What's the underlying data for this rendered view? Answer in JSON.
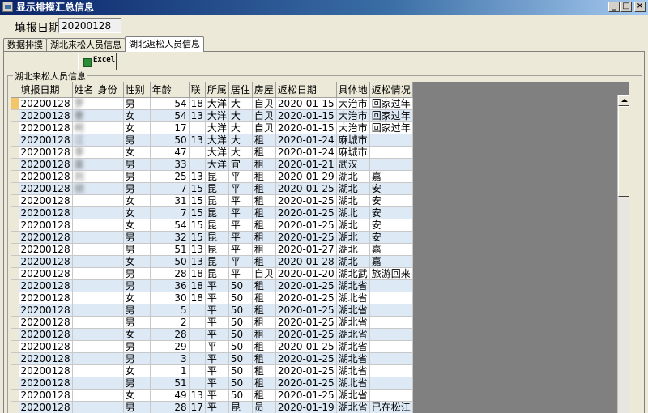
{
  "window": {
    "title": "显示排摸汇总信息",
    "buttons": {
      "minimize": "_",
      "maximize": "□",
      "close": "×"
    }
  },
  "header": {
    "label": "填报日期",
    "value": "20200128"
  },
  "tabs": [
    {
      "label": "数据排摸",
      "active": false
    },
    {
      "label": "湖北来松人员信息",
      "active": false
    },
    {
      "label": "湖北返松人员信息",
      "active": true
    }
  ],
  "toolbar": {
    "excel_label": "Excel"
  },
  "group": {
    "title": "湖北来松人员信息"
  },
  "grid": {
    "columns": [
      "填报日期",
      "姓名",
      "身份",
      "性别",
      "年龄",
      "联",
      "所属",
      "居住",
      "房屋",
      "返松日期",
      "具体地",
      "返松情况"
    ],
    "rows": [
      [
        "20200128",
        "罗",
        "",
        "男",
        "54",
        "18",
        "大洋",
        "大",
        "自贝",
        "2020-01-15",
        "大治市",
        "回家过年"
      ],
      [
        "20200128",
        "曹",
        "",
        "女",
        "54",
        "13",
        "大洋",
        "大",
        "自贝",
        "2020-01-15",
        "大治市",
        "回家过年"
      ],
      [
        "20200128",
        "柯",
        "",
        "女",
        "17",
        "",
        "大洋",
        "大",
        "自贝",
        "2020-01-15",
        "大治市",
        "回家过年"
      ],
      [
        "20200128",
        "江",
        "",
        "男",
        "50",
        "13",
        "大洋",
        "大",
        "租",
        "2020-01-24",
        "麻城市",
        ""
      ],
      [
        "20200128",
        "李",
        "",
        "女",
        "47",
        "",
        "大洋",
        "大",
        "租",
        "2020-01-24",
        "麻城市",
        ""
      ],
      [
        "20200128",
        "童",
        "",
        "男",
        "33",
        "",
        "大洋",
        "宜",
        "租",
        "2020-01-21",
        "武汉",
        ""
      ],
      [
        "20200128",
        "刘",
        "",
        "男",
        "25",
        "13",
        "昆",
        "平",
        "租",
        "2020-01-29",
        "湖北",
        "嘉"
      ],
      [
        "20200128",
        "胡",
        "",
        "男",
        "7",
        "15",
        "昆",
        "平",
        "租",
        "2020-01-25",
        "湖北",
        "安"
      ],
      [
        "20200128",
        "",
        "",
        "女",
        "31",
        "15",
        "昆",
        "平",
        "租",
        "2020-01-25",
        "湖北",
        "安"
      ],
      [
        "20200128",
        "",
        "",
        "女",
        "7",
        "15",
        "昆",
        "平",
        "租",
        "2020-01-25",
        "湖北",
        "安"
      ],
      [
        "20200128",
        "",
        "",
        "女",
        "54",
        "15",
        "昆",
        "平",
        "租",
        "2020-01-25",
        "湖北",
        "安"
      ],
      [
        "20200128",
        "",
        "",
        "男",
        "32",
        "15",
        "昆",
        "平",
        "租",
        "2020-01-25",
        "湖北",
        "安"
      ],
      [
        "20200128",
        "",
        "",
        "男",
        "51",
        "13",
        "昆",
        "平",
        "租",
        "2020-01-27",
        "湖北",
        "嘉"
      ],
      [
        "20200128",
        "",
        "",
        "女",
        "50",
        "13",
        "昆",
        "平",
        "租",
        "2020-01-28",
        "湖北",
        "嘉"
      ],
      [
        "20200128",
        "",
        "",
        "男",
        "28",
        "18",
        "昆",
        "平",
        "自贝",
        "2020-01-20",
        "湖北武",
        "旅游回来"
      ],
      [
        "20200128",
        "",
        "",
        "男",
        "36",
        "18",
        "平",
        "50",
        "租",
        "2020-01-25",
        "湖北省",
        ""
      ],
      [
        "20200128",
        "",
        "",
        "女",
        "30",
        "18",
        "平",
        "50",
        "租",
        "2020-01-25",
        "湖北省",
        ""
      ],
      [
        "20200128",
        "",
        "",
        "男",
        "5",
        "",
        "平",
        "50",
        "租",
        "2020-01-25",
        "湖北省",
        ""
      ],
      [
        "20200128",
        "",
        "",
        "男",
        "2",
        "",
        "平",
        "50",
        "租",
        "2020-01-25",
        "湖北省",
        ""
      ],
      [
        "20200128",
        "",
        "",
        "女",
        "28",
        "",
        "平",
        "50",
        "租",
        "2020-01-25",
        "湖北省",
        ""
      ],
      [
        "20200128",
        "",
        "",
        "男",
        "29",
        "",
        "平",
        "50",
        "租",
        "2020-01-25",
        "湖北省",
        ""
      ],
      [
        "20200128",
        "",
        "",
        "男",
        "3",
        "",
        "平",
        "50",
        "租",
        "2020-01-25",
        "湖北省",
        ""
      ],
      [
        "20200128",
        "",
        "",
        "女",
        "1",
        "",
        "平",
        "50",
        "租",
        "2020-01-25",
        "湖北省",
        ""
      ],
      [
        "20200128",
        "",
        "",
        "男",
        "51",
        "",
        "平",
        "50",
        "租",
        "2020-01-25",
        "湖北省",
        ""
      ],
      [
        "20200128",
        "",
        "",
        "女",
        "49",
        "13",
        "平",
        "50",
        "租",
        "2020-01-25",
        "湖北省",
        ""
      ],
      [
        "20200128",
        "",
        "",
        "男",
        "28",
        "17",
        "平",
        "昆",
        "员",
        "2020-01-19",
        "湖北省",
        "已在松江"
      ]
    ]
  }
}
